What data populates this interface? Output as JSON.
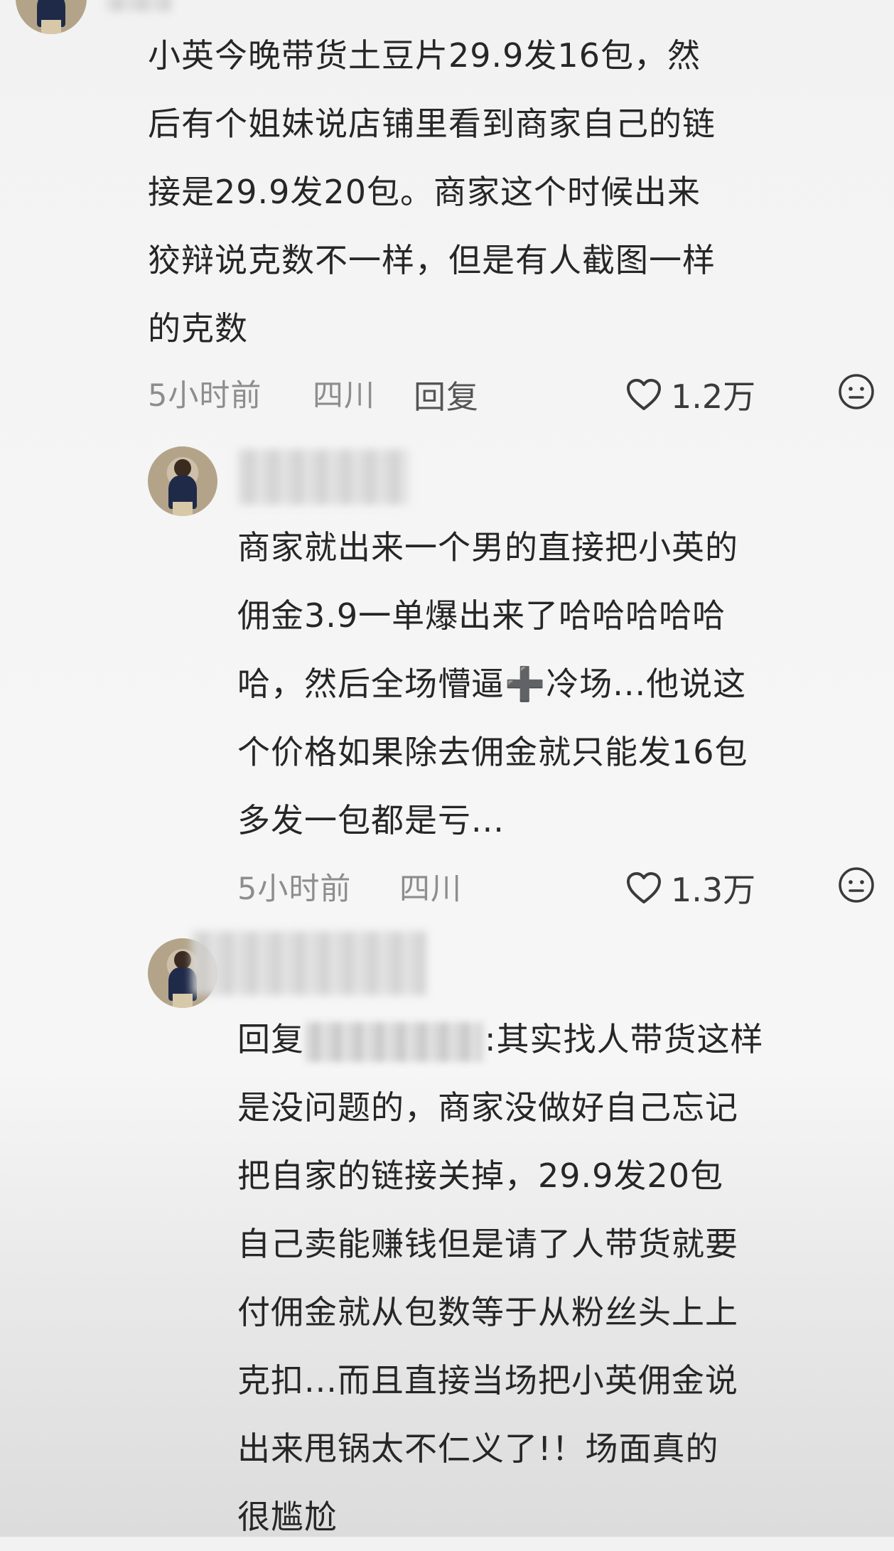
{
  "comments": [
    {
      "lines": [
        "小英今晚带货土豆片29.9发16包，然",
        "后有个姐妹说店铺里看到商家自己的链",
        "接是29.9发20包。商家这个时候出来",
        "狡辩说克数不一样，但是有人截图一样",
        "的克数"
      ],
      "time": "5小时前",
      "location": "四川",
      "reply_label": "回复",
      "likes": "1.2万"
    },
    {
      "lines": [
        "商家就出来一个男的直接把小英的",
        "佣金3.9一单爆出来了哈哈哈哈哈",
        "哈，然后全场懵逼➕冷场...他说这",
        "个价格如果除去佣金就只能发16包",
        "多发一包都是亏..."
      ],
      "time": "5小时前",
      "location": "四川",
      "likes": "1.3万"
    },
    {
      "reply_prefix": "回复",
      "first_line_rest": ":其实找人带货这样",
      "lines": [
        "是没问题的，商家没做好自己忘记",
        "把自家的链接关掉，29.9发20包",
        "自己卖能赚钱但是请了人带货就要",
        "付佣金就从包数等于从粉丝头上上",
        "克扣...而且直接当场把小英佣金说",
        "出来甩锅太不仁义了!！场面真的",
        "很尴尬"
      ]
    }
  ],
  "icons": {
    "like": "heart-outline-icon",
    "emoji": "neutral-face-icon"
  },
  "colors": {
    "text": "#262626",
    "meta": "#8d8d8d"
  }
}
